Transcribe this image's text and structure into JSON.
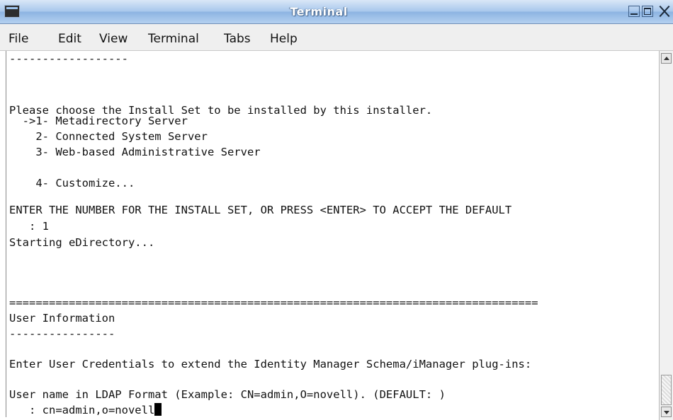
{
  "window": {
    "title": "Terminal",
    "icons": {
      "app": "terminal-icon",
      "minimize": "minimize-icon",
      "maximize": "maximize-icon",
      "close": "close-icon"
    }
  },
  "menubar": {
    "items": [
      "File",
      "Edit",
      "View",
      "Terminal",
      "Tabs",
      "Help"
    ]
  },
  "terminal": {
    "lines": [
      "------------------",
      "",
      "Please choose the Install Set to be installed by this installer.",
      "",
      "  ->1- Metadirectory Server",
      "    2- Connected System Server",
      "    3- Web-based Administrative Server",
      "",
      "    4- Customize...",
      "",
      "ENTER THE NUMBER FOR THE INSTALL SET, OR PRESS <ENTER> TO ACCEPT THE DEFAULT",
      "   : 1",
      "Starting eDirectory...",
      "",
      "",
      "",
      "================================================================================",
      "User Information",
      "----------------",
      "",
      "Enter User Credentials to extend the Identity Manager Schema/iManager plug-ins:",
      "",
      "User name in LDAP Format (Example: CN=admin,O=novell). (DEFAULT: )",
      "   : cn=admin,o=novell"
    ]
  },
  "scrollbar": {
    "icons": {
      "up": "scroll-up-arrow-icon",
      "down": "scroll-down-arrow-icon"
    }
  }
}
